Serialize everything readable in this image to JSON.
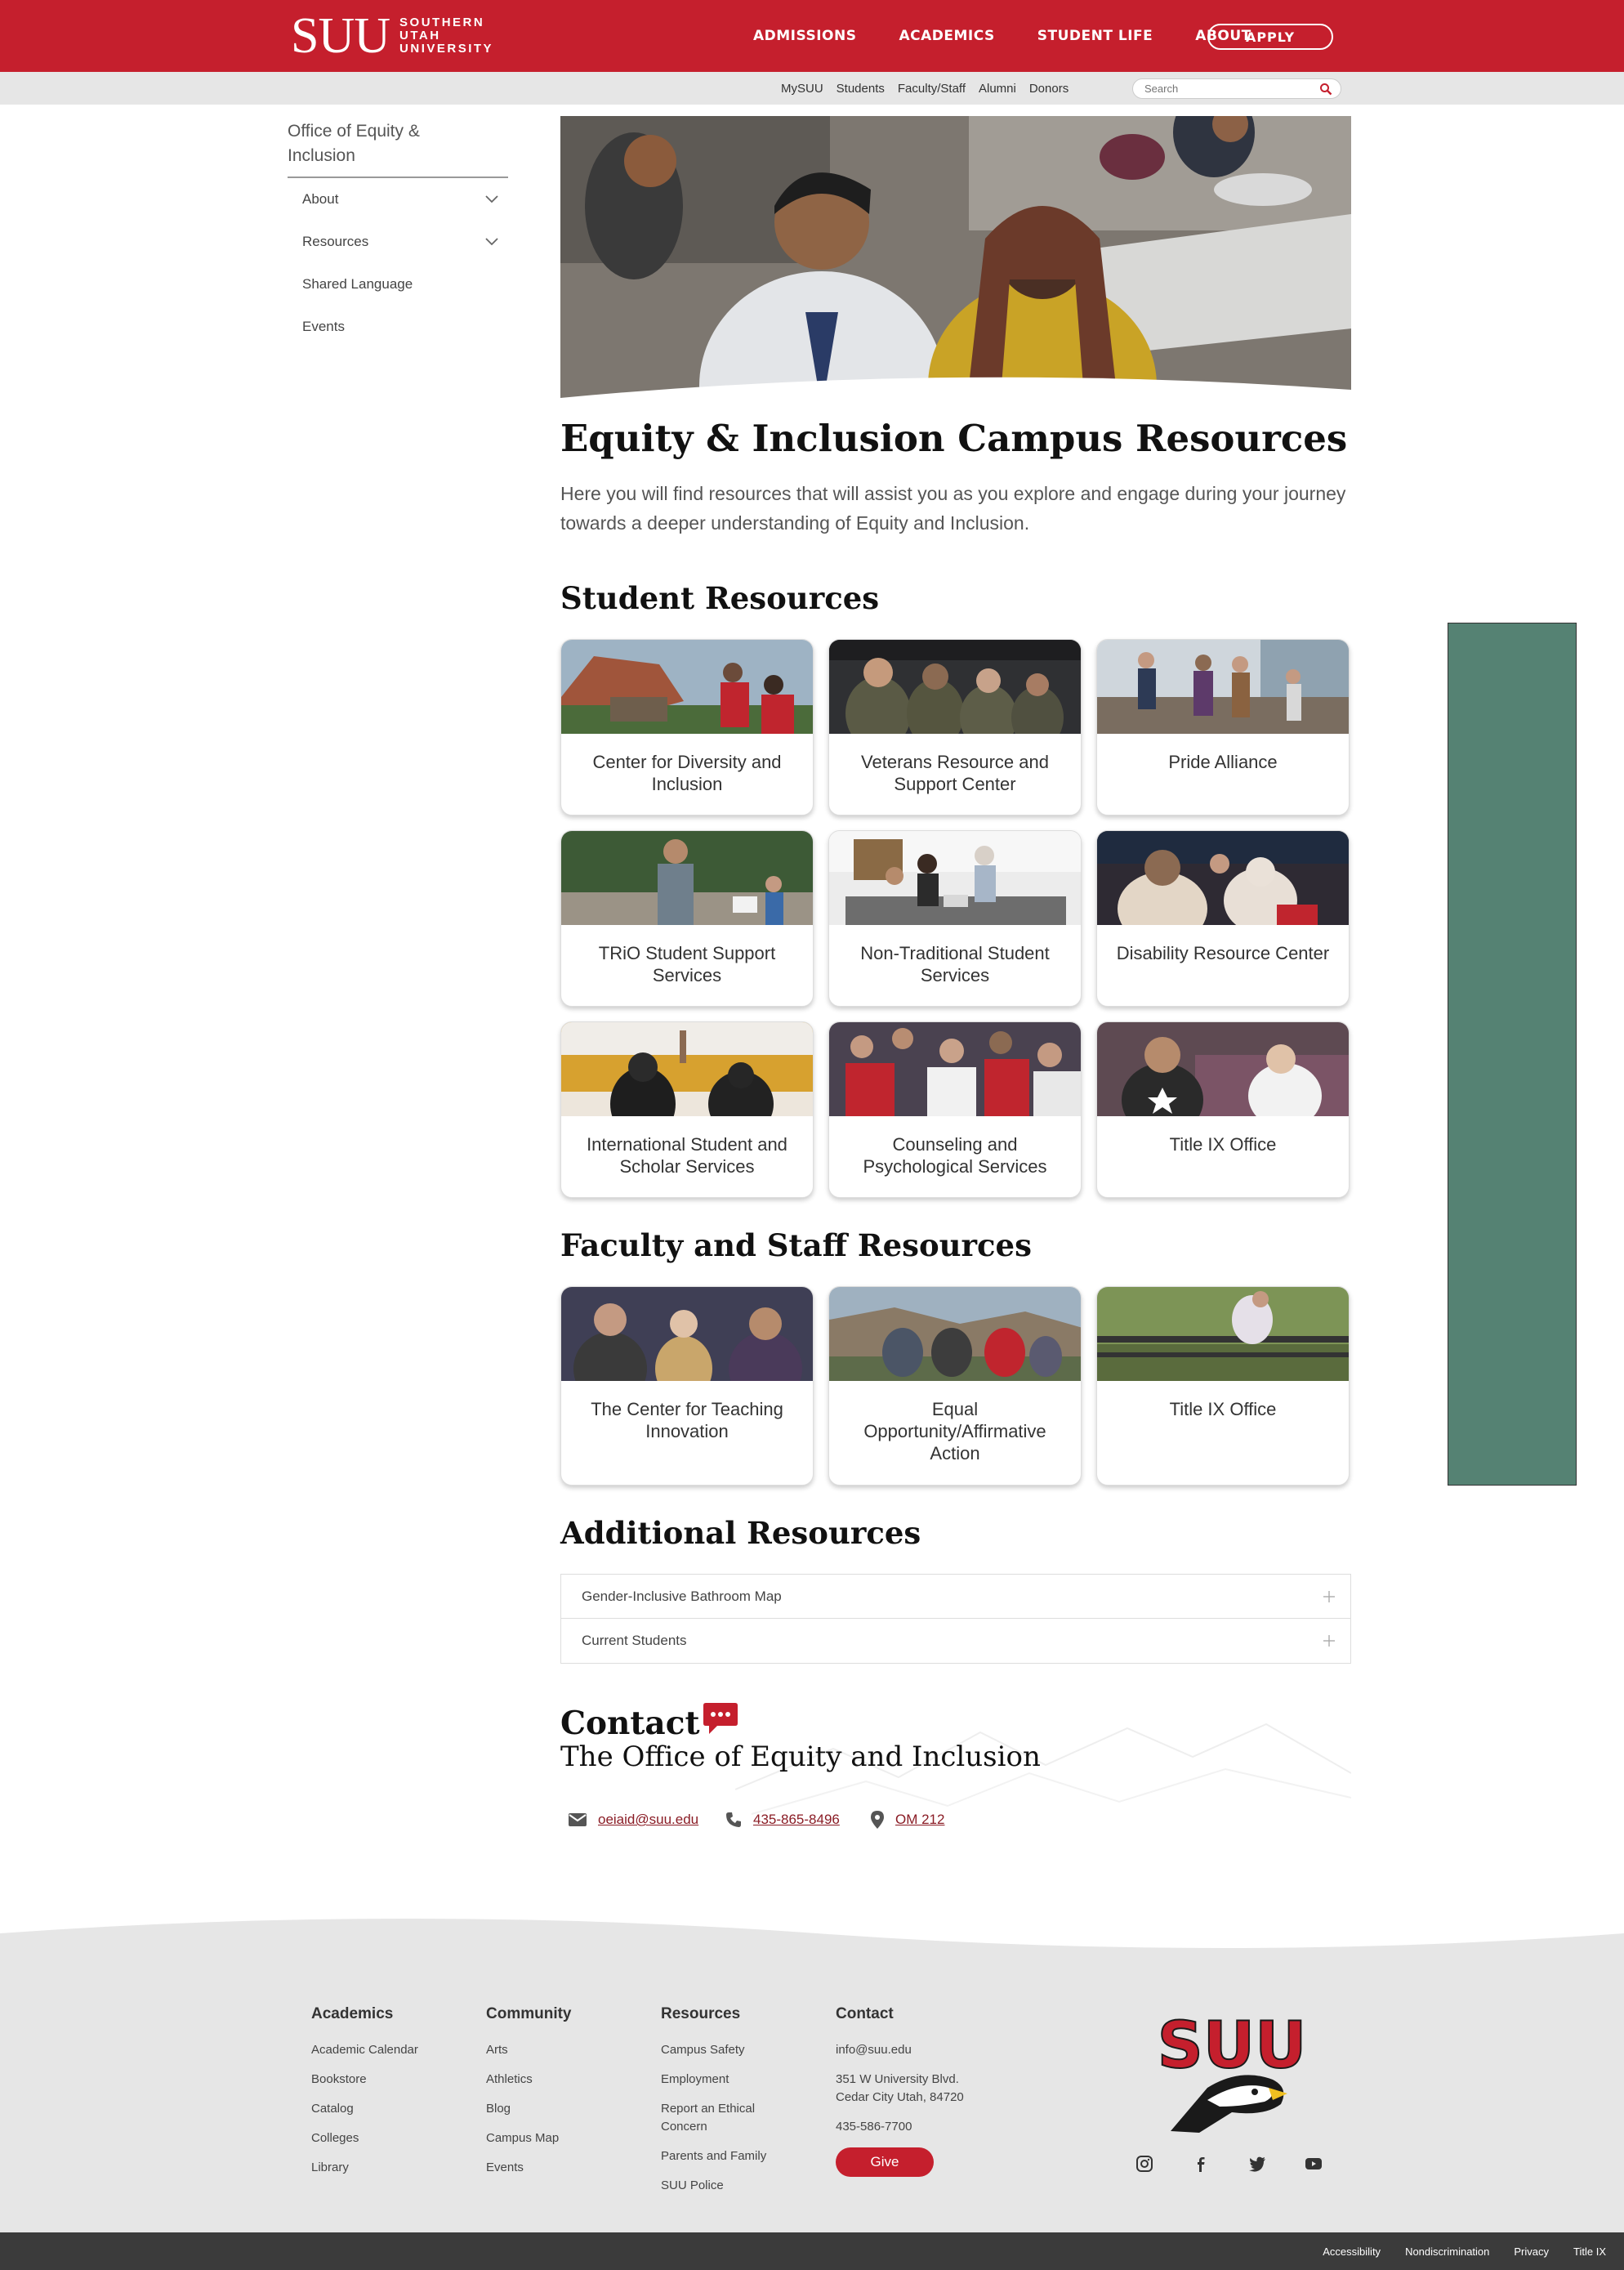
{
  "header": {
    "logo_mark": "SUU",
    "logo_words": [
      "SOUTHERN",
      "UTAH",
      "UNIVERSITY"
    ],
    "nav": [
      "ADMISSIONS",
      "ACADEMICS",
      "STUDENT LIFE",
      "ABOUT"
    ],
    "apply": "APPLY"
  },
  "utility": {
    "links": [
      "MySUU",
      "Students",
      "Faculty/Staff",
      "Alumni",
      "Donors"
    ],
    "search_placeholder": "Search"
  },
  "sidebar": {
    "title": "Office of Equity & Inclusion",
    "items": [
      {
        "label": "About",
        "expandable": true
      },
      {
        "label": "Resources",
        "expandable": true
      },
      {
        "label": "Shared Language",
        "expandable": false
      },
      {
        "label": "Events",
        "expandable": false
      }
    ]
  },
  "main": {
    "title": "Equity & Inclusion Campus Resources",
    "intro": "Here you will find resources that will assist you as you explore and engage during your journey towards a deeper understanding of Equity and Inclusion.",
    "student_heading": "Student Resources",
    "student_cards": [
      "Center for Diversity and Inclusion",
      "Veterans Resource and Support Center",
      "Pride Alliance",
      "TRiO Student Support Services",
      "Non-Traditional Student Services",
      "Disability Resource Center",
      "International Student and Scholar Services",
      "Counseling and Psychological Services",
      "Title IX Office"
    ],
    "faculty_heading": "Faculty and Staff Resources",
    "faculty_cards": [
      "The Center for Teaching Innovation",
      "Equal Opportunity/Affirmative Action",
      "Title IX Office"
    ],
    "additional_heading": "Additional Resources",
    "accordion": [
      "Gender-Inclusive Bathroom Map",
      "Current Students"
    ]
  },
  "contact": {
    "heading": "Contact",
    "subheading": "The Office of Equity and Inclusion",
    "email": "oeiaid@suu.edu",
    "phone": "435-865-8496",
    "location": "OM 212"
  },
  "footer": {
    "academics": {
      "heading": "Academics",
      "links": [
        "Academic Calendar",
        "Bookstore",
        "Catalog",
        "Colleges",
        "Library"
      ]
    },
    "community": {
      "heading": "Community",
      "links": [
        "Arts",
        "Athletics",
        "Blog",
        "Campus Map",
        "Events"
      ]
    },
    "resources": {
      "heading": "Resources",
      "links": [
        "Campus Safety",
        "Employment",
        "Report an Ethical Concern",
        "Parents and Family",
        "SUU Police"
      ]
    },
    "contact": {
      "heading": "Contact",
      "email": "info@suu.edu",
      "address_line1": "351 W University Blvd.",
      "address_line2": "Cedar City Utah, 84720",
      "phone": "435-586-7700",
      "give": "Give"
    },
    "logo_text": "SUU",
    "legal": [
      "Accessibility",
      "Nondiscrimination",
      "Privacy",
      "Title IX"
    ]
  },
  "colors": {
    "brand_red": "#c51f2d",
    "panel_green": "#558273",
    "footer_gray": "#e6e6e6",
    "bottom_bar": "#3b3b3b"
  }
}
